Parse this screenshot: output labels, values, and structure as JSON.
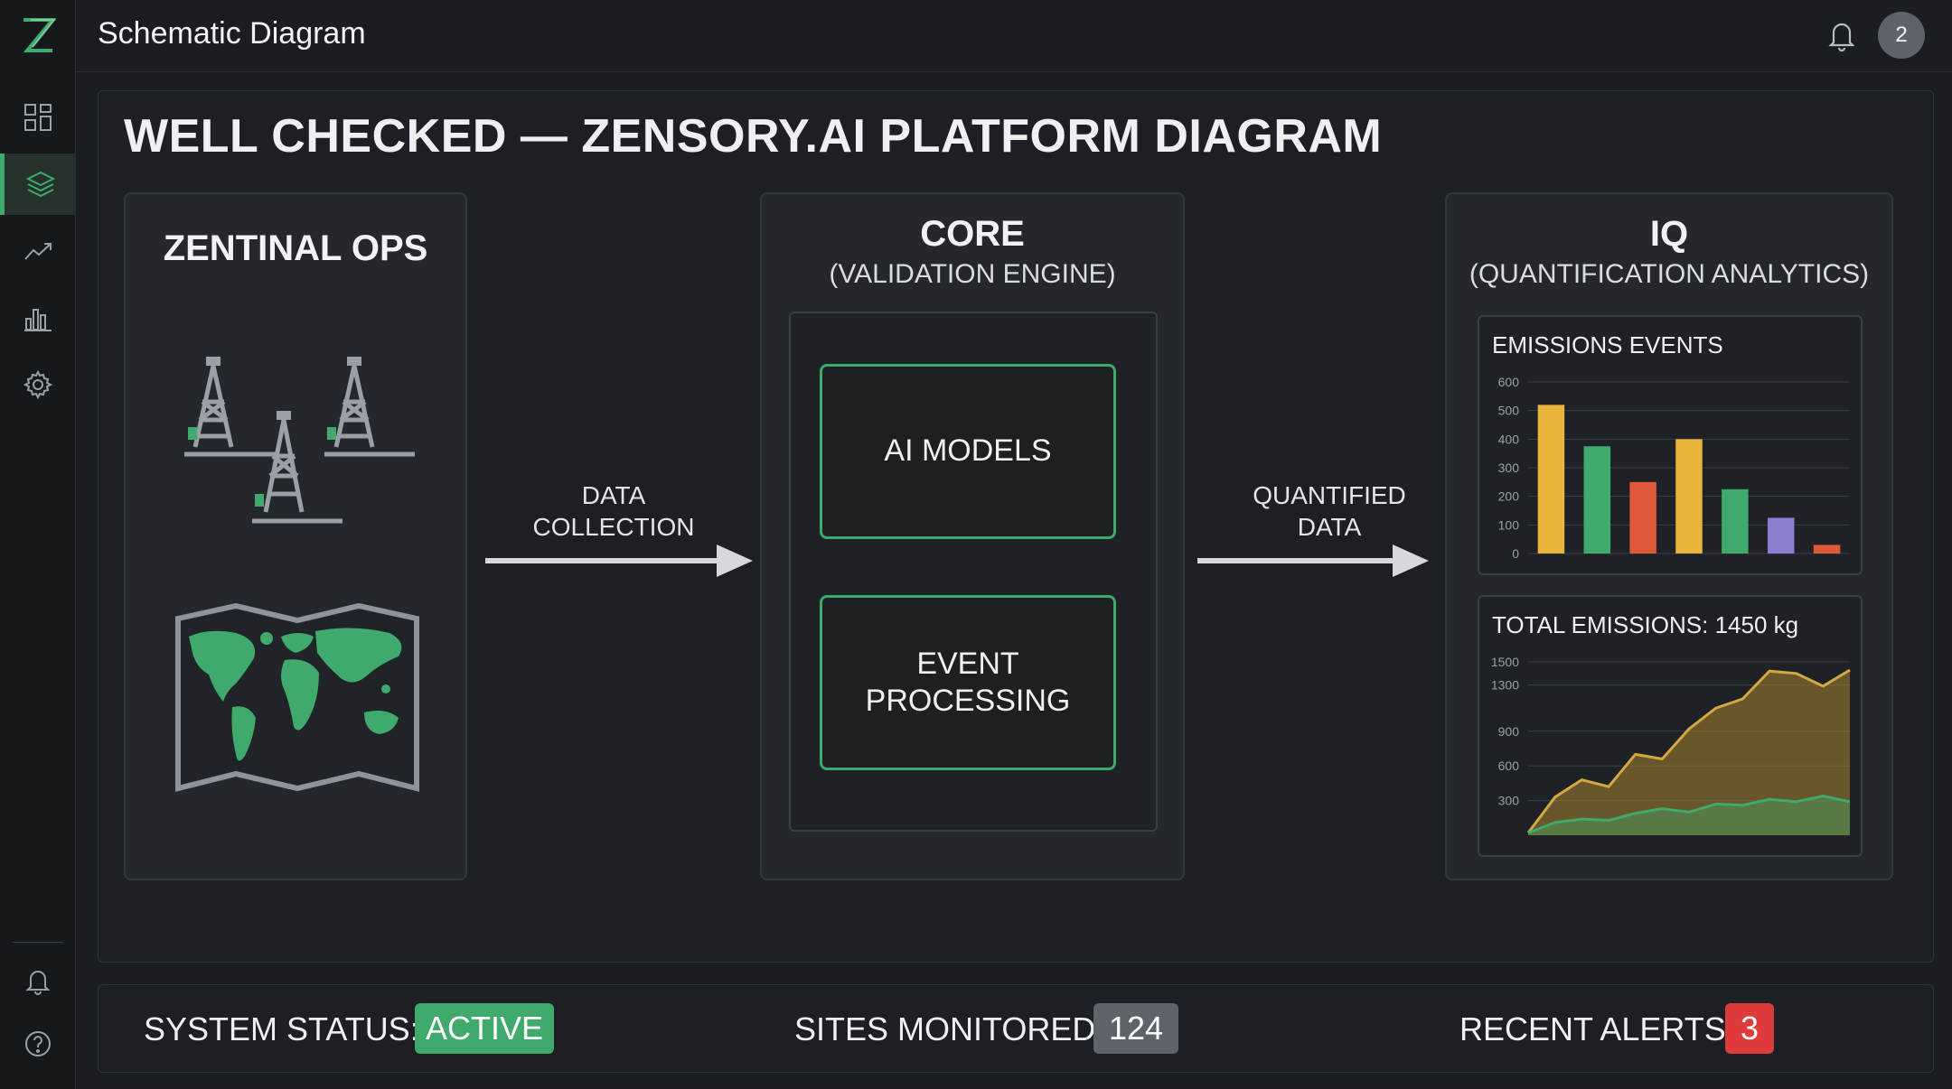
{
  "topbar": {
    "title": "Schematic Diagram",
    "avatar_text": "2"
  },
  "diagram": {
    "title": "WELL CHECKED — ZENSORY.AI PLATFORM DIAGRAM",
    "ops": {
      "title": "ZENTINAL OPS"
    },
    "arrow1": {
      "line1": "DATA",
      "line2": "COLLECTION"
    },
    "core": {
      "title": "CORE",
      "subtitle": "(VALIDATION ENGINE)",
      "box1": "AI MODELS",
      "box2_line1": "EVENT",
      "box2_line2": "PROCESSING"
    },
    "arrow2": {
      "line1": "QUANTIFIED",
      "line2": "DATA"
    },
    "iq": {
      "title": "IQ",
      "subtitle": "(QUANTIFICATION ANALYTICS)"
    }
  },
  "chart_data": [
    {
      "type": "bar",
      "title": "EMISSIONS EVENTS",
      "ylim": [
        0,
        600
      ],
      "yticks": [
        "0",
        "100",
        "200",
        "300",
        "400",
        "500",
        "600"
      ],
      "values": [
        520,
        375,
        250,
        400,
        225,
        125,
        30
      ],
      "colors": [
        "#e8b53a",
        "#3faa6b",
        "#e05a3a",
        "#e8b53a",
        "#3faa6b",
        "#8a7fd0",
        "#e05a3a"
      ],
      "grid": true
    },
    {
      "type": "area",
      "title": "TOTAL EMISSIONS: 1450 kg",
      "ylim": [
        0,
        1500
      ],
      "yticks": [
        "300",
        "600",
        "900",
        "1300",
        "1500"
      ],
      "series": [
        {
          "values": [
            20,
            330,
            480,
            420,
            700,
            660,
            920,
            1100,
            1180,
            1420,
            1400,
            1290,
            1430
          ],
          "color": "#d4a843"
        },
        {
          "values": [
            20,
            110,
            140,
            130,
            190,
            230,
            200,
            270,
            260,
            310,
            290,
            340,
            290
          ],
          "color": "#3faa6b"
        }
      ]
    }
  ],
  "status": {
    "system_label": "SYSTEM STATUS:",
    "system_value": "ACTIVE",
    "sites_label": "SITES MONITORED:",
    "sites_value": "124",
    "alerts_label": "RECENT ALERTS:",
    "alerts_value": "3"
  },
  "colors": {
    "accent": "#3faa6b",
    "alert": "#e03b3b",
    "neutral_badge": "#5e6369"
  },
  "icons": {
    "sidebar": [
      "dashboard-icon",
      "layers-icon",
      "trend-icon",
      "bar-chart-icon",
      "gear-icon"
    ],
    "sidebar_bottom": [
      "bell-icon",
      "help-icon"
    ],
    "top": [
      "bell-icon"
    ]
  }
}
